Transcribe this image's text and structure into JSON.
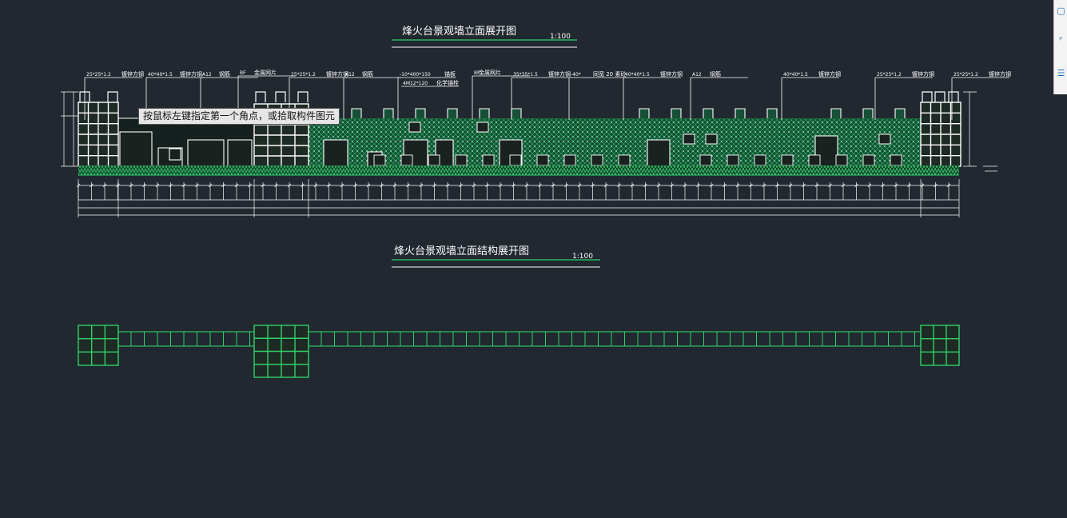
{
  "drawing": {
    "elevation_title": "烽火台景观墙立面展开图",
    "elevation_scale": "1:100",
    "structure_title": "烽火台景观墙立面结构展开图",
    "structure_scale": "1:100"
  },
  "annotations": [
    {
      "spec": "25*25*1.2",
      "name": "镀锌方钢"
    },
    {
      "spec": "40*40*1.5",
      "name": "镀锌方钢"
    },
    {
      "spec": "A12",
      "name": "钢筋"
    },
    {
      "spec": "BF",
      "name": "金属网片"
    },
    {
      "spec": "25*25*1.2",
      "name": "镀锌方钢"
    },
    {
      "spec": "A12",
      "name": "钢筋"
    },
    {
      "spec": "-10*400*150",
      "name": "锚板"
    },
    {
      "spec": "4M12*120",
      "name": "化学锚栓"
    },
    {
      "spec": "BF",
      "name": "金属网片"
    },
    {
      "spec": "35*35*1.5",
      "name": "镀锌方钢"
    },
    {
      "spec": "-40*",
      "name": "同宽 20 素砼"
    },
    {
      "spec": "40*40*1.5",
      "name": "镀锌方钢"
    },
    {
      "spec": "A12",
      "name": "钢筋"
    },
    {
      "spec": "40*40*1.5",
      "name": "镀锌方钢"
    },
    {
      "spec": "25*25*1.2",
      "name": "镀锌方钢"
    },
    {
      "spec": "25*25*1.2",
      "name": "镀锌方钢"
    }
  ],
  "tooltip": {
    "text": "按鼠标左键指定第一个角点，或拾取构件图元"
  },
  "colors": {
    "background": "#212830",
    "cad_green": "#2fd16a",
    "cad_white": "#ffffff",
    "mesh_fill": "#1d6b47"
  },
  "toolbar": {
    "icons": [
      "document-icon",
      "select-icon",
      "list-icon"
    ]
  }
}
